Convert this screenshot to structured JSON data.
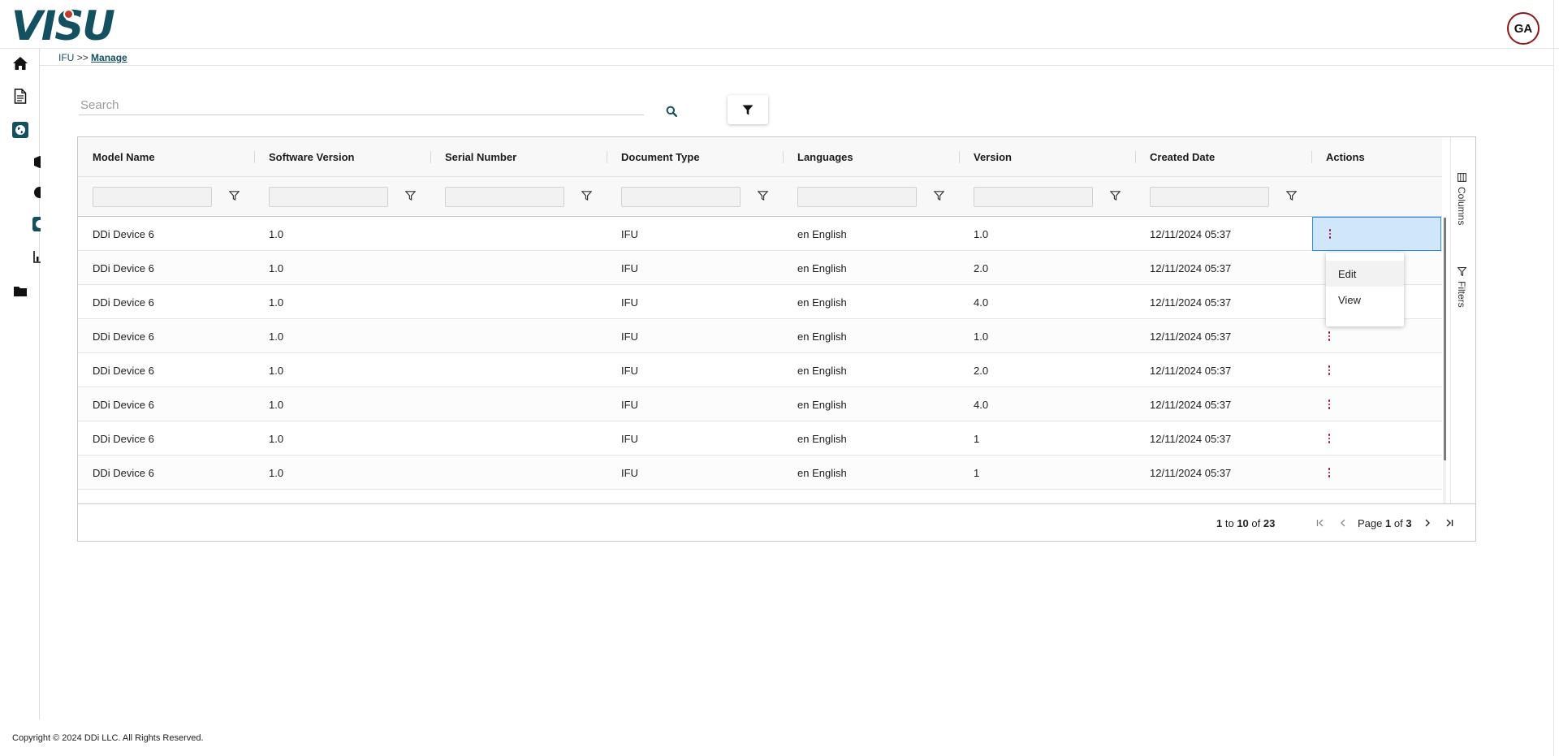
{
  "header": {
    "logo_text": "VISU",
    "avatar_initials": "GA"
  },
  "sidebar": {
    "items": [
      {
        "icon": "home-icon"
      },
      {
        "icon": "document-icon"
      },
      {
        "icon": "globe-icon",
        "active": true
      },
      {
        "icon": "box-icon"
      },
      {
        "icon": "circle-half-icon"
      },
      {
        "icon": "globe-icon",
        "active": true
      },
      {
        "icon": "chart-icon"
      },
      {
        "icon": "folder-icon"
      }
    ]
  },
  "breadcrumb": {
    "root": "IFU",
    "separator": ">>",
    "current": "Manage"
  },
  "search": {
    "placeholder": "Search",
    "value": ""
  },
  "grid": {
    "columns": [
      "Model Name",
      "Software Version",
      "Serial Number",
      "Document Type",
      "Languages",
      "Version",
      "Created Date",
      "Actions"
    ],
    "rows": [
      {
        "model": "DDi Device 6",
        "software": "1.0",
        "serial": "",
        "doctype": "IFU",
        "lang": "en English",
        "version": "1.0",
        "created": "12/11/2024 05:37"
      },
      {
        "model": "DDi Device 6",
        "software": "1.0",
        "serial": "",
        "doctype": "IFU",
        "lang": "en English",
        "version": "2.0",
        "created": "12/11/2024 05:37"
      },
      {
        "model": "DDi Device 6",
        "software": "1.0",
        "serial": "",
        "doctype": "IFU",
        "lang": "en English",
        "version": "4.0",
        "created": "12/11/2024 05:37"
      },
      {
        "model": "DDi Device 6",
        "software": "1.0",
        "serial": "",
        "doctype": "IFU",
        "lang": "en English",
        "version": "1.0",
        "created": "12/11/2024 05:37"
      },
      {
        "model": "DDi Device 6",
        "software": "1.0",
        "serial": "",
        "doctype": "IFU",
        "lang": "en English",
        "version": "2.0",
        "created": "12/11/2024 05:37"
      },
      {
        "model": "DDi Device 6",
        "software": "1.0",
        "serial": "",
        "doctype": "IFU",
        "lang": "en English",
        "version": "4.0",
        "created": "12/11/2024 05:37"
      },
      {
        "model": "DDi Device 6",
        "software": "1.0",
        "serial": "",
        "doctype": "IFU",
        "lang": "en English",
        "version": "1",
        "created": "12/11/2024 05:37"
      },
      {
        "model": "DDi Device 6",
        "software": "1.0",
        "serial": "",
        "doctype": "IFU",
        "lang": "en English",
        "version": "1",
        "created": "12/11/2024 05:37"
      }
    ],
    "side_tabs": {
      "columns": "Columns",
      "filters": "Filters"
    },
    "action_menu": {
      "edit": "Edit",
      "view": "View"
    }
  },
  "pagination": {
    "from": "1",
    "to_word": "to",
    "to": "10",
    "of_word": "of",
    "total": "23",
    "page_word": "Page",
    "page": "1",
    "page_of_word": "of",
    "pages": "3"
  },
  "footer": {
    "copyright": "Copyright © 2024 DDi LLC. All Rights Reserved."
  },
  "colors": {
    "brand": "#135060",
    "accent": "#a5102d",
    "selected_bg": "#cfe6fb",
    "selected_border": "#2a8ef0"
  }
}
